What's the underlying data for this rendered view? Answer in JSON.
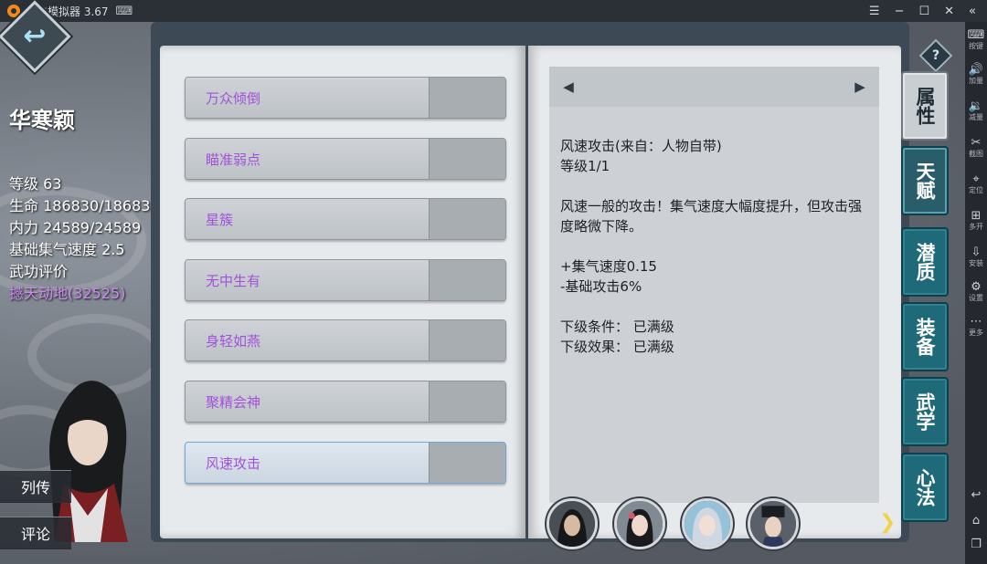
{
  "emulator": {
    "title": "雷电模拟器 3.67",
    "sidebar": [
      {
        "icon": "keyboard-icon",
        "label": "按键"
      },
      {
        "icon": "volume-up-icon",
        "label": "加量"
      },
      {
        "icon": "volume-down-icon",
        "label": "减量"
      },
      {
        "icon": "scissors-icon",
        "label": "截图"
      },
      {
        "icon": "location-pin-icon",
        "label": "定位"
      },
      {
        "icon": "multi-window-icon",
        "label": "多开"
      },
      {
        "icon": "apk-install-icon",
        "label": "安装"
      },
      {
        "icon": "settings-gear-icon",
        "label": "设置"
      },
      {
        "icon": "more-dots-icon",
        "label": "更多"
      }
    ]
  },
  "character": {
    "name": "华寒颖",
    "level": "等级 63",
    "hp": "生命 186830/186830",
    "mp": "内力 24589/24589",
    "speed": "基础集气速度 2.5",
    "rating_label": "武功评价",
    "rating_value": "撼天动地(32525)"
  },
  "side_buttons": {
    "bio": "列传",
    "comment": "评论"
  },
  "skills": [
    {
      "name": "万众倾倒"
    },
    {
      "name": "瞄准弱点"
    },
    {
      "name": "星簇"
    },
    {
      "name": "无中生有"
    },
    {
      "name": "身轻如燕"
    },
    {
      "name": "聚精会神"
    },
    {
      "name": "风速攻击",
      "selected": true
    }
  ],
  "detail": {
    "title": "风速攻击(来自：人物自带)",
    "level": "等级1/1",
    "desc": "风速一般的攻击！集气速度大幅度提升，但攻击强度略微下降。",
    "bonus1": "+集气速度0.15",
    "bonus2": "-基础攻击6%",
    "next_cond": "下级条件：  已满级",
    "next_effect": "下级效果：  已满级"
  },
  "tabs": [
    "属性",
    "天赋",
    "潜质",
    "装备",
    "武学",
    "心法"
  ],
  "help_label": "?"
}
